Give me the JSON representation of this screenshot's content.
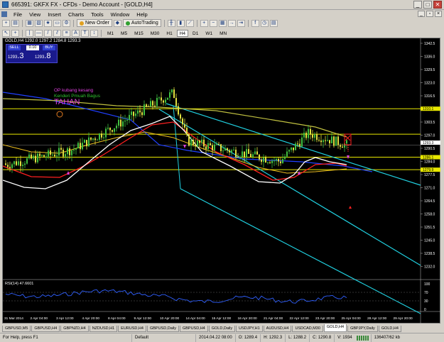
{
  "window": {
    "title": "665391: GKFX FX - CFDs - Demo Account - [GOLD,H4]"
  },
  "menu": [
    "File",
    "View",
    "Insert",
    "Charts",
    "Tools",
    "Window",
    "Help"
  ],
  "toolbar": {
    "new_order": "New Order",
    "autotrading": "AutoTrading"
  },
  "timeframes": [
    "M1",
    "M5",
    "M15",
    "M30",
    "H1",
    "H4",
    "D1",
    "W1",
    "MN"
  ],
  "active_timeframe": "H4",
  "chart": {
    "symbol_label": "GOLD,H4  1292.0 1297.2 1284.8 1293.3",
    "trade_panel": {
      "sell": "SELL",
      "buy": "BUY",
      "volume": "0.10",
      "bid_small": "1293",
      "bid_big": ".3",
      "ask_small": "1293",
      "ask_big": ".8"
    },
    "annotations": {
      "line1": "OP kubang kesang",
      "line2": "Kenderi Pmuah Bagus",
      "line3": "TAHAN"
    },
    "price_labels": [
      "1342.5",
      "1336.0",
      "1329.5",
      "1323.0",
      "1316.5",
      "1310.0",
      "1303.5",
      "1297.0",
      "1290.5",
      "1284.0",
      "1277.5",
      "1271.0",
      "1264.5",
      "1258.0",
      "1251.5",
      "1245.0",
      "1238.5",
      "1232.0"
    ],
    "markers": [
      "1310.1",
      "1293.3",
      "1286.1",
      "1279.9"
    ],
    "date_labels": [
      "31 Mar 2014",
      "2 Apr 04:00",
      "3 Apr 12:00",
      "4 Apr 20:00",
      "8 Apr 04:00",
      "9 Apr 12:00",
      "10 Apr 20:00",
      "14 Apr 04:00",
      "15 Apr 12:00",
      "16 Apr 20:00",
      "21 Apr 04:00",
      "22 Apr 12:00",
      "23 Apr 20:00",
      "25 Apr 04:00",
      "28 Apr 12:00",
      "29 Apr 20:00"
    ],
    "rsi_label": "RSI(14) 47.6601",
    "rsi_scale": [
      "100",
      "70",
      "30",
      "0"
    ],
    "colors": {
      "background": "#000000",
      "candle_up": "#40c040",
      "candle_down": "#e0e040",
      "channel": "#20d0e0",
      "hline": "#e8e800",
      "ma_white": "#ffffff",
      "ma_red": "#ff2020",
      "ma_yellow": "#f0c020",
      "ma_blue": "#2040ff",
      "ma_olive": "#c0c040"
    }
  },
  "tabs": [
    "GBPUSD,M5",
    "GBPUSD,H4",
    "GBPNZD,H4",
    "NZDUSD,H1",
    "EURUSD,H4",
    "GBPUSD,Daily",
    "GBPUSD,H4",
    "GOLD,Daily",
    "USDJPY,H1",
    "AUDUSD,H4",
    "USDCAD,M30",
    "GOLD,H4",
    "GBPJPY,Daily",
    "GOLD,H4"
  ],
  "active_tab": 11,
  "status": {
    "help": "For Help, press F1",
    "profile": "Default",
    "datetime": "2014.04.22 08:00",
    "open": "O: 1289.4",
    "high": "H: 1292.3",
    "low": "L: 1288.2",
    "close": "C: 1290.8",
    "volume": "V: 1934",
    "traffic": "136407/62 kb"
  }
}
